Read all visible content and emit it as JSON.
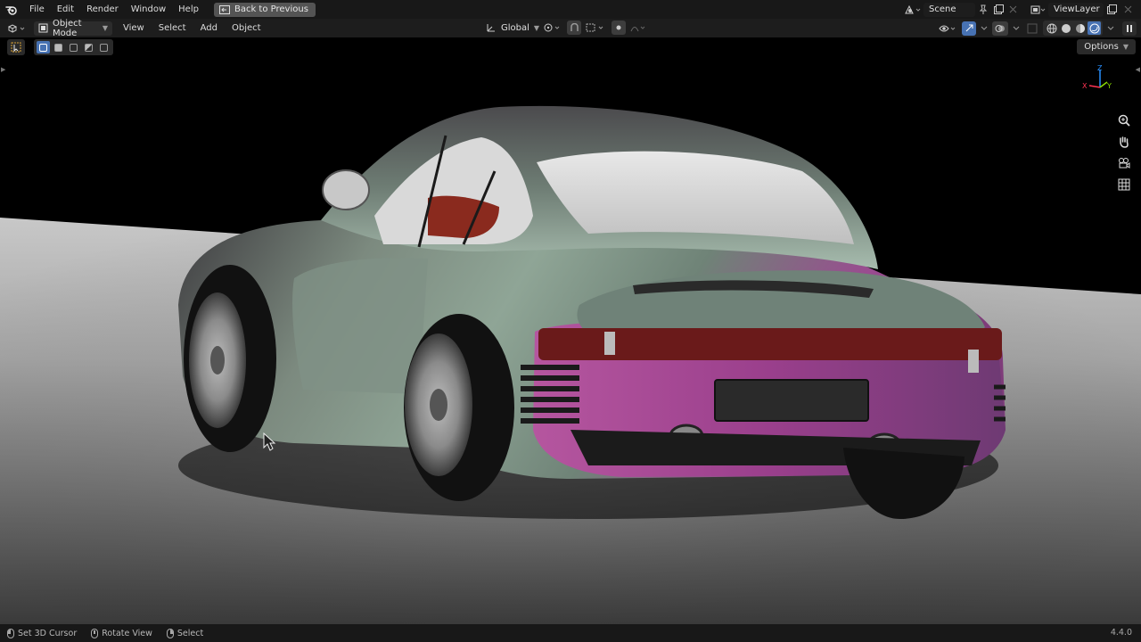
{
  "topbar": {
    "logo_icon": "blender-logo-icon",
    "menus": [
      "File",
      "Edit",
      "Render",
      "Window",
      "Help"
    ],
    "back_button": "Back to Previous",
    "scene_name": "Scene",
    "view_layer": "ViewLayer"
  },
  "viewport_header": {
    "mode": "Object Mode",
    "menus": [
      "View",
      "Select",
      "Add",
      "Object"
    ],
    "transform_orientation": "Global",
    "options_label": "Options"
  },
  "gizmo": {
    "axis_z": "Z",
    "axis_y": "Y",
    "axis_x": "X",
    "colors": {
      "x": "#ff3352",
      "y": "#8bdc00",
      "z": "#2890ff"
    }
  },
  "statusbar": {
    "hints": [
      "Set 3D Cursor",
      "Rotate View",
      "Select"
    ],
    "version": "4.4.0"
  },
  "colors": {
    "topbar_bg": "#181818",
    "header_bg": "#1d1d1d",
    "accent_blue": "#4772b3",
    "floor": "#9a9a9a",
    "car_body_green": "#5d7468",
    "car_body_magenta": "#a54a90"
  }
}
